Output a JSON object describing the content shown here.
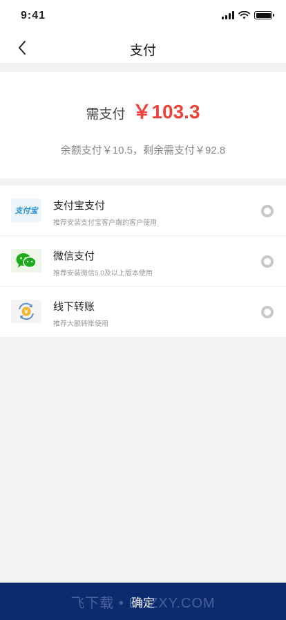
{
  "status_bar": {
    "time": "9:41"
  },
  "nav": {
    "title": "支付"
  },
  "payment": {
    "need_label": "需支付",
    "amount": "￥103.3",
    "balance_info": "余额支付￥10.5，剩余需支付￥92.8"
  },
  "methods": [
    {
      "title": "支付宝支付",
      "subtitle": "推荐安装支付宝客户端的客户使用",
      "icon": "alipay-icon",
      "logo_text": "支付宝"
    },
    {
      "title": "微信支付",
      "subtitle": "推荐安装微信5.0及以上版本使用",
      "icon": "wechat-icon"
    },
    {
      "title": "线下转账",
      "subtitle": "推荐大额转账使用",
      "icon": "transfer-icon",
      "logo_text": "￥"
    }
  ],
  "confirm": {
    "label": "确定"
  },
  "watermark": "飞下载 • BHZXY.COM",
  "colors": {
    "accent": "#e8463c",
    "confirm_bg": "#0c2a6e"
  }
}
